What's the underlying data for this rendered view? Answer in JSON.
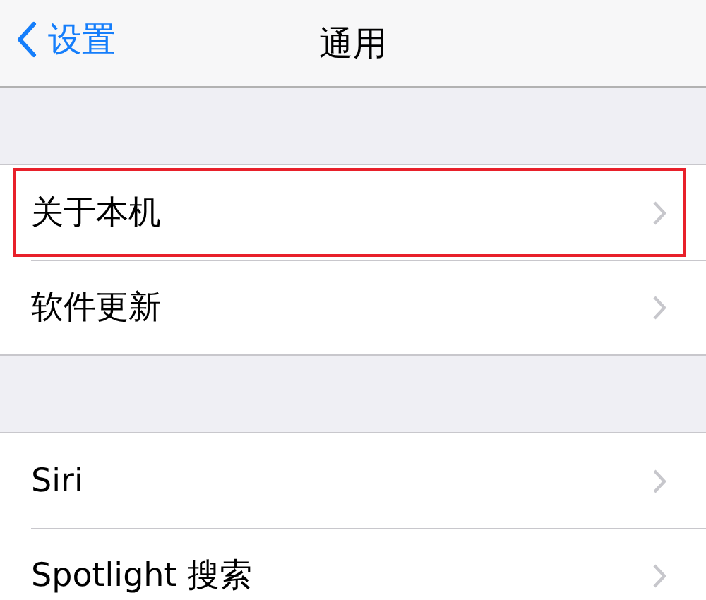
{
  "nav_bar": {
    "back_label": "设置",
    "title": "通用"
  },
  "groups": [
    {
      "rows": [
        {
          "label": "关于本机",
          "highlighted": true
        },
        {
          "label": "软件更新",
          "highlighted": false
        }
      ]
    },
    {
      "rows": [
        {
          "label": "Siri",
          "highlighted": false
        },
        {
          "label": "Spotlight 搜索",
          "highlighted": false
        }
      ]
    }
  ]
}
